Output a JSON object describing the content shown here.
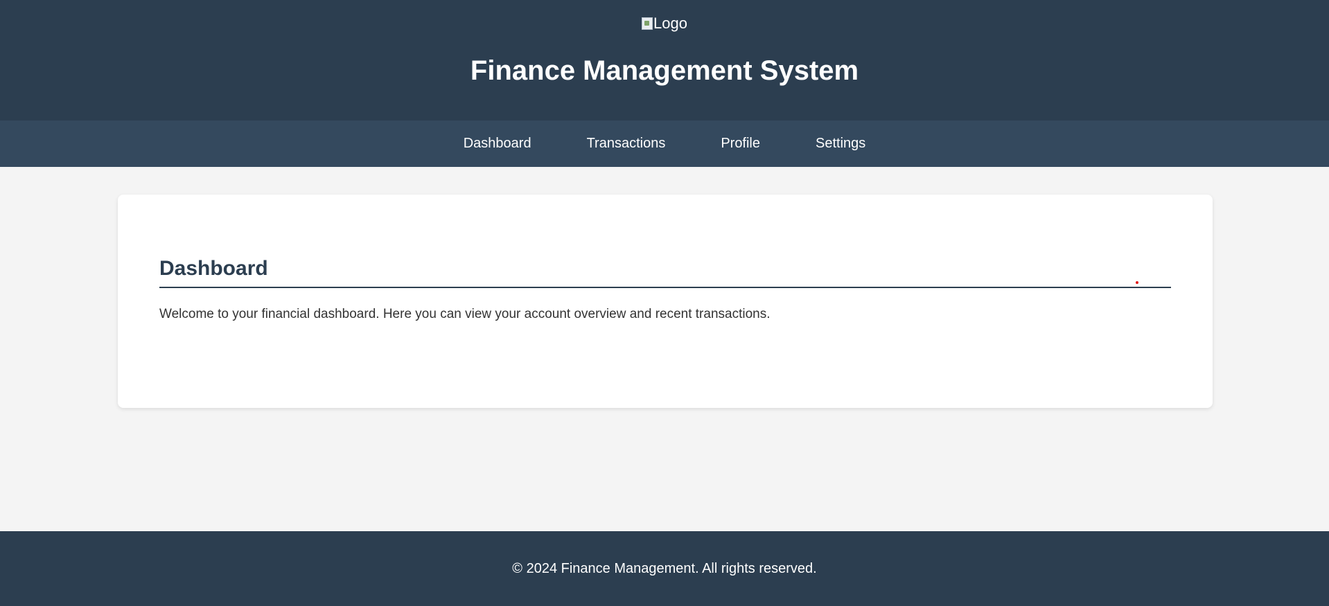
{
  "header": {
    "logo_alt": "Logo",
    "title": "Finance Management System"
  },
  "nav": {
    "items": [
      {
        "label": "Dashboard"
      },
      {
        "label": "Transactions"
      },
      {
        "label": "Profile"
      },
      {
        "label": "Settings"
      }
    ]
  },
  "main": {
    "heading": "Dashboard",
    "description": "Welcome to your financial dashboard. Here you can view your account overview and recent transactions."
  },
  "footer": {
    "copyright": "© 2024 Finance Management. All rights reserved."
  },
  "colors": {
    "header_bg": "#2c3e50",
    "nav_bg": "#34495e",
    "page_bg": "#f4f4f4",
    "card_bg": "#ffffff",
    "heading": "#2c3e50",
    "text": "#333333"
  },
  "icons": {
    "logo": "broken-image-icon"
  }
}
